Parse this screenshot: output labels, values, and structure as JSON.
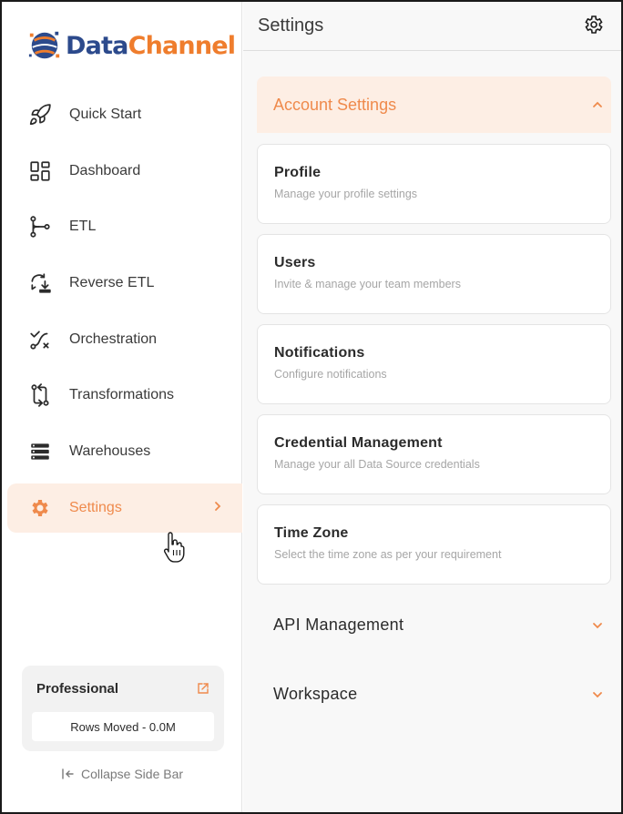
{
  "brand": {
    "name_part1": "Data",
    "name_part2": "Channel"
  },
  "sidebar": {
    "items": [
      {
        "label": "Quick Start",
        "icon": "rocket-icon"
      },
      {
        "label": "Dashboard",
        "icon": "dashboard-grid-icon"
      },
      {
        "label": "ETL",
        "icon": "etl-flow-icon"
      },
      {
        "label": "Reverse ETL",
        "icon": "reverse-etl-icon"
      },
      {
        "label": "Orchestration",
        "icon": "orchestration-icon"
      },
      {
        "label": "Transformations",
        "icon": "transformations-icon"
      },
      {
        "label": "Warehouses",
        "icon": "warehouse-icon"
      },
      {
        "label": "Settings",
        "icon": "gear-icon",
        "active": true
      }
    ],
    "plan": {
      "title": "Professional",
      "rows_moved": "Rows Moved - 0.0M"
    },
    "collapse_label": "Collapse Side Bar"
  },
  "header": {
    "title": "Settings"
  },
  "account_settings": {
    "title": "Account Settings",
    "cards": [
      {
        "title": "Profile",
        "subtitle": "Manage your profile settings"
      },
      {
        "title": "Users",
        "subtitle": "Invite & manage your team members"
      },
      {
        "title": "Notifications",
        "subtitle": "Configure notifications"
      },
      {
        "title": "Credential Management",
        "subtitle": "Manage your all Data Source credentials"
      },
      {
        "title": "Time Zone",
        "subtitle": "Select the time zone as per your requirement"
      }
    ]
  },
  "sections": [
    {
      "title": "API Management"
    },
    {
      "title": "Workspace"
    }
  ],
  "colors": {
    "accent": "#ef8a4c",
    "accent_bg": "#fdeee4",
    "brand_blue": "#2c4a8c",
    "brand_orange": "#ef7d2d"
  }
}
